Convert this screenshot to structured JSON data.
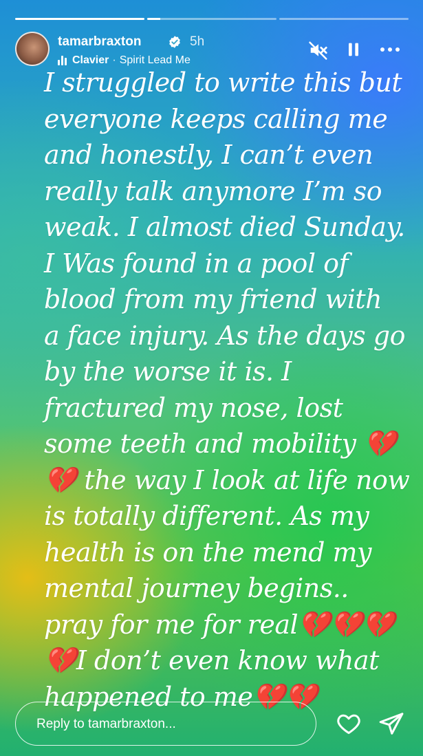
{
  "story": {
    "progress": [
      1.0,
      0.1,
      0.0
    ],
    "user": {
      "name": "tamarbraxton",
      "time": "5h",
      "verified": true
    },
    "music": {
      "artist": "Clavier",
      "separator": "·",
      "track": "Spirit Lead Me"
    },
    "text": "I struggled to write this but\neveryone keeps calling me\nand honestly, I can’t even\nreally talk anymore I’m so\nweak. I almost died Sunday.\nI Was found in a pool of\nblood from my friend with\na face injury. As the days go\nby the worse it is. I\nfractured my nose, lost\nsome teeth and mobility 💔\n💔 the way I look at life now\nis totally different. As my\nhealth is on the mend my\nmental journey begins..\npray for me for real💔💔💔\n💔I  don’t even know what\nhappened to me💔💔",
    "reply_placeholder": "Reply to tamarbraxton..."
  },
  "icons": {
    "mute": "speaker-muted-icon",
    "pause": "pause-icon",
    "more": "more-horizontal-icon",
    "like": "heart-icon",
    "share": "send-icon",
    "verified": "verified-badge-icon"
  },
  "colors": {
    "verified": "#ffffff",
    "text": "#ffffff"
  }
}
